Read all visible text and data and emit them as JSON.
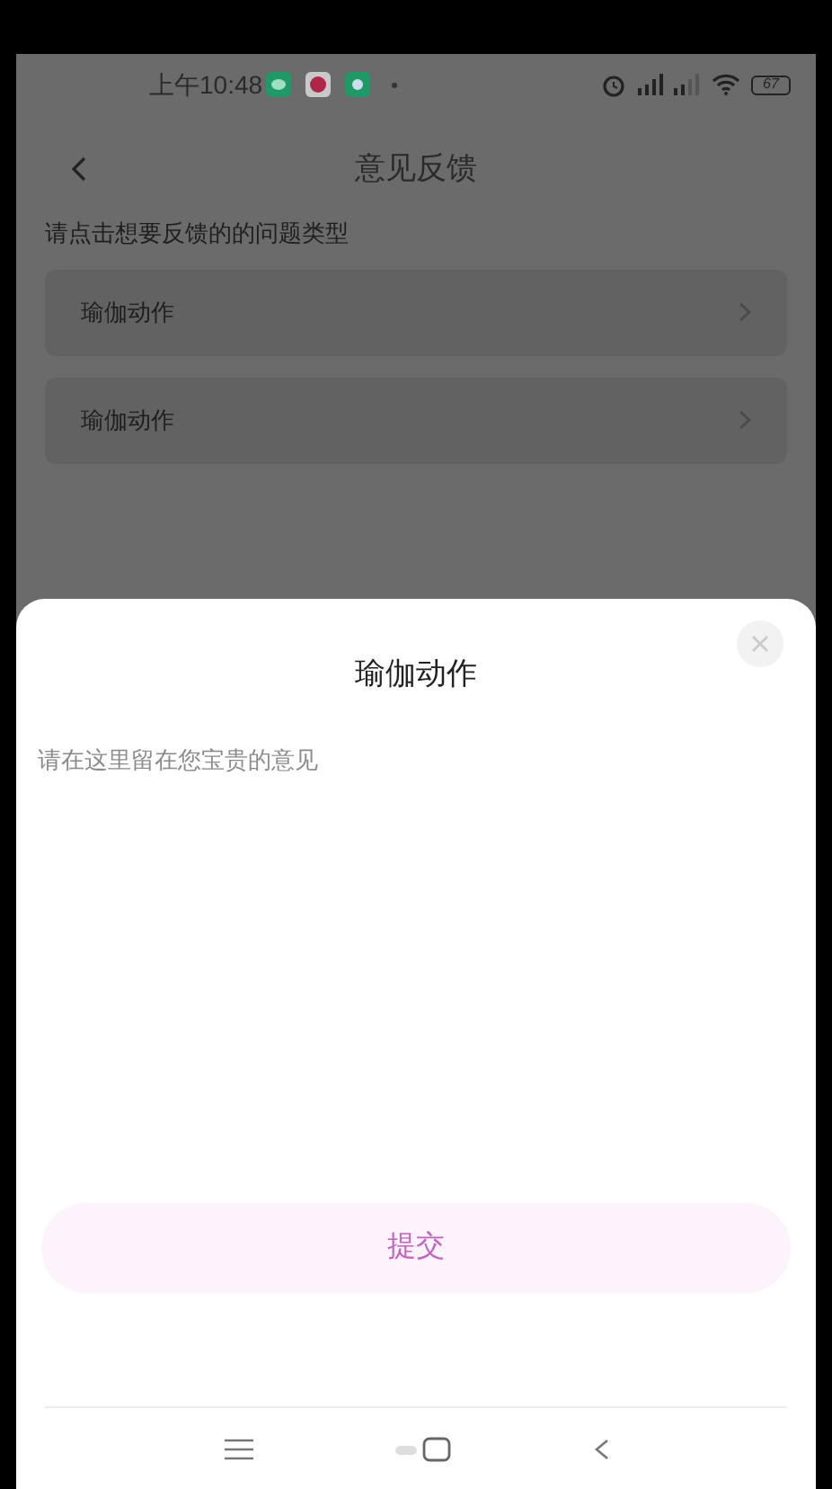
{
  "status_bar": {
    "time": "上午10:48",
    "battery": "67"
  },
  "header": {
    "title": "意见反馈"
  },
  "prompt": "请点击想要反馈的的问题类型",
  "categories": [
    {
      "label": "瑜伽动作"
    },
    {
      "label": "瑜伽动作"
    }
  ],
  "sheet": {
    "title": "瑜伽动作",
    "placeholder": "请在这里留在您宝贵的意见",
    "submit": "提交"
  }
}
